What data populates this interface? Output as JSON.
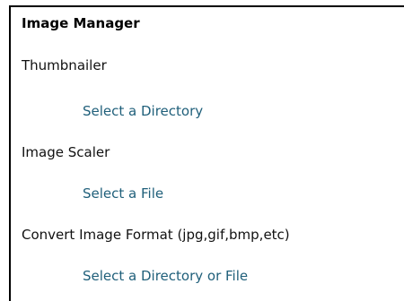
{
  "panel": {
    "title": "Image Manager",
    "sections": [
      {
        "label": "Thumbnailer",
        "link": "Select a Directory"
      },
      {
        "label": "Image Scaler",
        "link": "Select a File"
      },
      {
        "label": "Convert Image Format (jpg,gif,bmp,etc)",
        "link": "Select a Directory or File"
      }
    ]
  },
  "colors": {
    "link": "#1f5f7a",
    "border": "#000000"
  }
}
